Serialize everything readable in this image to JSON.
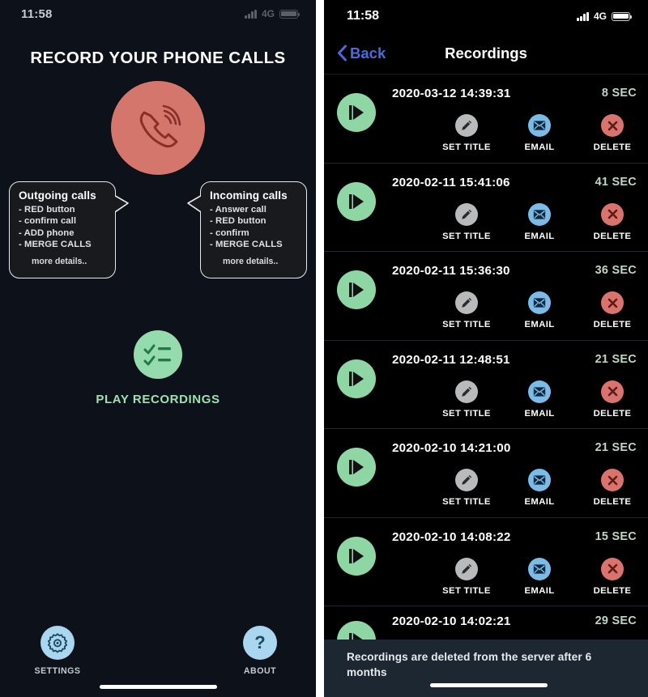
{
  "left": {
    "status": {
      "time": "11:58",
      "network": "4G"
    },
    "title": "RECORD YOUR PHONE CALLS",
    "phone_button": {
      "icon": "phone-call-icon",
      "color": "#d4766c"
    },
    "callouts": [
      {
        "heading": "Outgoing calls",
        "lines": [
          "- RED button",
          "- confirm call",
          "- ADD phone",
          "- MERGE CALLS"
        ],
        "more": "more details.."
      },
      {
        "heading": "Incoming calls",
        "lines": [
          "- Answer call",
          "- RED button",
          "- confirm",
          "- MERGE CALLS"
        ],
        "more": "more details.."
      }
    ],
    "play_recordings": {
      "label": "PLAY RECORDINGS",
      "icon": "checklist-icon",
      "color": "#96dbad"
    },
    "bottom": [
      {
        "label": "SETTINGS",
        "icon": "gear-icon",
        "color": "#aad6ef"
      },
      {
        "label": "ABOUT",
        "icon": "question-mark-icon",
        "color": "#aad6ef"
      }
    ]
  },
  "right": {
    "status": {
      "time": "11:58",
      "network": "4G"
    },
    "nav": {
      "back": "Back",
      "title": "Recordings",
      "back_icon": "chevron-left-icon",
      "accent": "#4b6bdd"
    },
    "action_labels": {
      "set_title": "SET TITLE",
      "email": "EMAIL",
      "delete": "DELETE"
    },
    "action_icons": {
      "set_title": "pencil-icon",
      "email": "envelope-icon",
      "delete": "x-circle-icon"
    },
    "play_icon": "play-icon",
    "recordings": [
      {
        "date": "2020-03-12 14:39:31",
        "duration": "8 SEC"
      },
      {
        "date": "2020-02-11 15:41:06",
        "duration": "41 SEC"
      },
      {
        "date": "2020-02-11 15:36:30",
        "duration": "36 SEC"
      },
      {
        "date": "2020-02-11 12:48:51",
        "duration": "21 SEC"
      },
      {
        "date": "2020-02-10 14:21:00",
        "duration": "21 SEC"
      },
      {
        "date": "2020-02-10 14:08:22",
        "duration": "15 SEC"
      },
      {
        "date": "2020-02-10 14:02:21",
        "duration": "29 SEC"
      }
    ],
    "footer_note": "Recordings are deleted from the server after 6 months"
  }
}
